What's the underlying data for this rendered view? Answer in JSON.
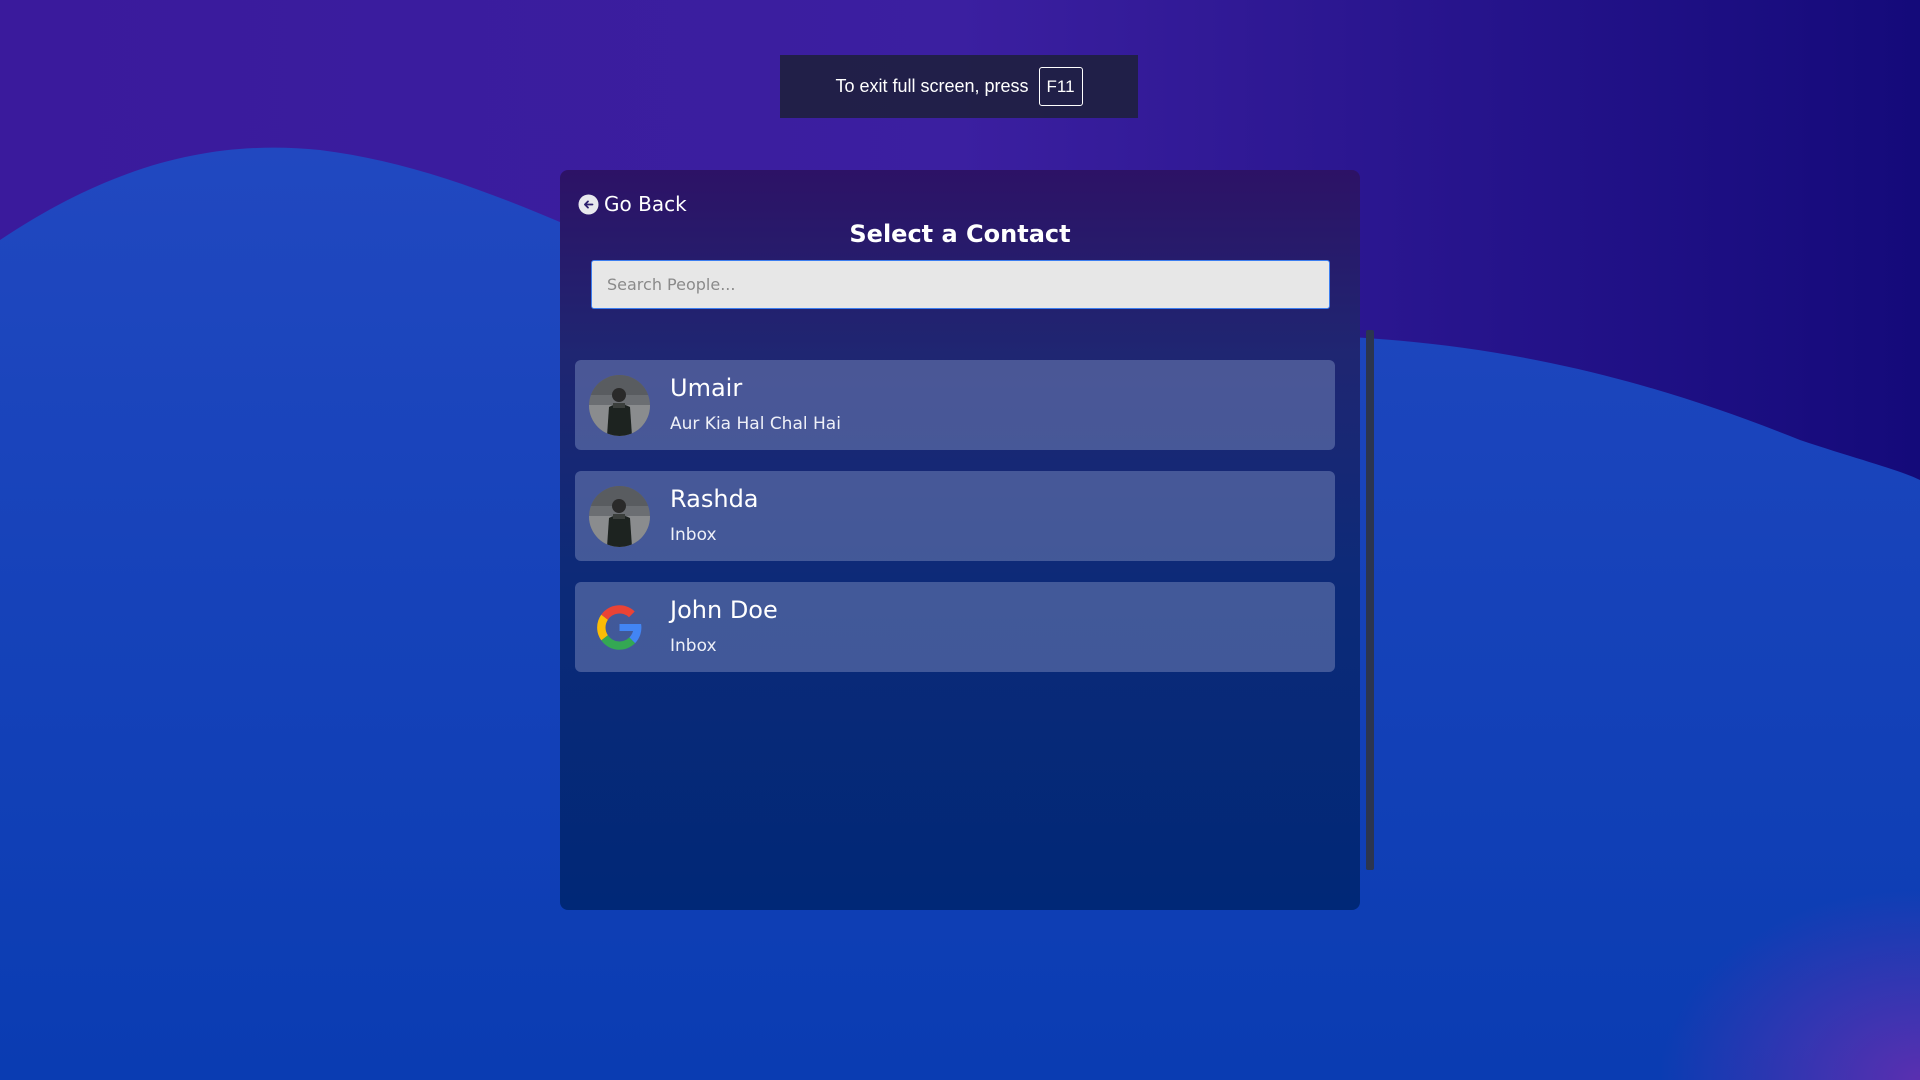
{
  "toast": {
    "message": "To exit full screen, press",
    "key": "F11"
  },
  "panel": {
    "go_back_label": "Go Back",
    "title": "Select a Contact",
    "search_placeholder": "Search People..."
  },
  "contacts": [
    {
      "name": "Umair",
      "preview": "Aur Kia Hal Chal Hai",
      "avatar": "photo"
    },
    {
      "name": "Rashda",
      "preview": "Inbox",
      "avatar": "photo"
    },
    {
      "name": "John Doe",
      "preview": "Inbox",
      "avatar": "google-logo"
    }
  ],
  "colors": {
    "bg_purple": "#2a1596",
    "bg_blue": "#0a3bb4",
    "panel_top": "#2d1266",
    "panel_bottom": "#002877",
    "card": "#4a5a96"
  }
}
